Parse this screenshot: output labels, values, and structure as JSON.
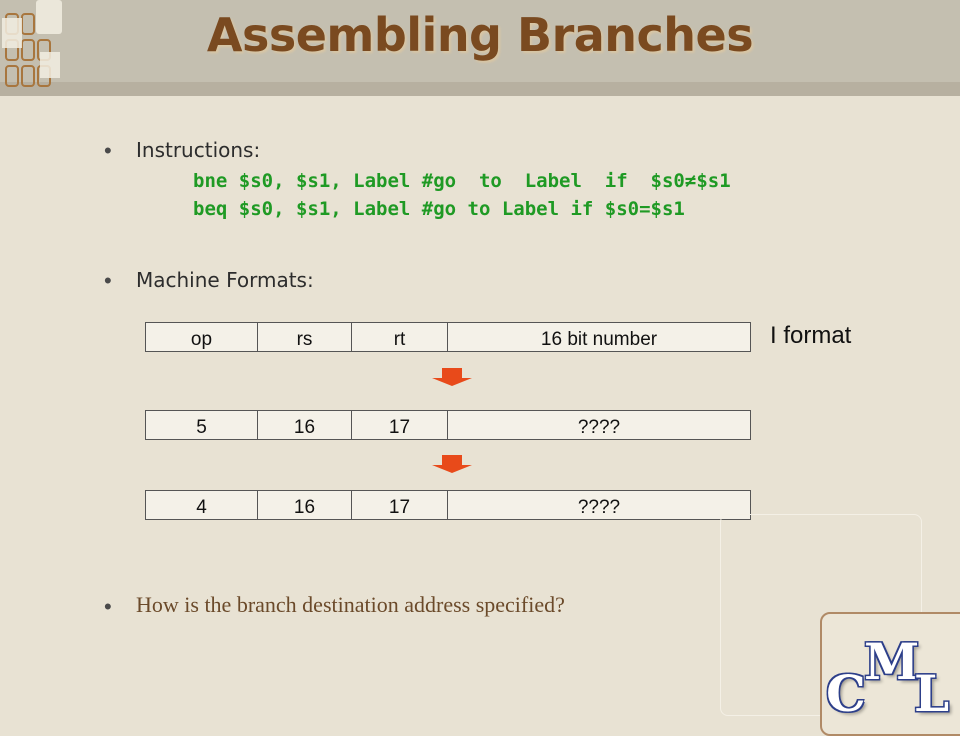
{
  "slide": {
    "title": "Assembling Branches",
    "bullets": [
      {
        "text": "Instructions:"
      },
      {
        "text": "Machine Formats:"
      }
    ],
    "code_lines": [
      "bne $s0, $s1, Label #go  to  Label  if  $s0≠$s1",
      "beq $s0, $s1, Label #go to Label if $s0=$s1"
    ],
    "format_label": "I  format",
    "question": "How is the branch destination address specified?",
    "logo": {
      "letters": [
        "C",
        "M",
        "L"
      ]
    }
  },
  "rows": [
    {
      "cells": [
        "op",
        "rs",
        "rt",
        "16 bit number"
      ]
    },
    {
      "cells": [
        "5",
        "16",
        "17",
        "????"
      ]
    },
    {
      "cells": [
        "4",
        "16",
        "17",
        "????"
      ]
    }
  ],
  "colors": {
    "title": "#7a4a20",
    "code": "#1f9a24",
    "arrow": "#e84a1a",
    "question": "#6b4a2a",
    "logo_outline": "#2d3f8a"
  }
}
